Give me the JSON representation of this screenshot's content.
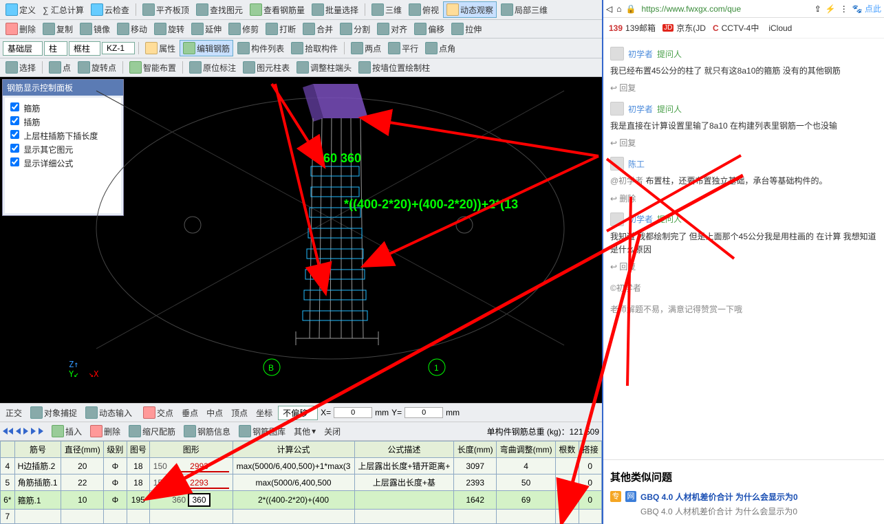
{
  "toolbars": {
    "row1": [
      "定义",
      "∑ 汇总计算",
      "云检查",
      "平齐板顶",
      "查找图元",
      "查看钢筋量",
      "批量选择",
      "三维",
      "俯视",
      "动态观察",
      "局部三维"
    ],
    "row2": [
      "删除",
      "复制",
      "镜像",
      "移动",
      "旋转",
      "延伸",
      "修剪",
      "打断",
      "合并",
      "分割",
      "对齐",
      "偏移",
      "拉伸"
    ],
    "row3_selects": {
      "floor": "基础层",
      "type": "柱",
      "shape": "框柱",
      "id": "KZ-1"
    },
    "row3": [
      "属性",
      "编辑钢筋",
      "构件列表",
      "拾取构件",
      "两点",
      "平行",
      "点角"
    ],
    "row4": [
      "选择",
      "点",
      "旋转点",
      "智能布置",
      "原位标注",
      "图元柱表",
      "调整柱端头",
      "按墙位置绘制柱"
    ]
  },
  "panel": {
    "title": "钢筋显示控制面板",
    "items": [
      "箍筋",
      "插筋",
      "上层柱插筋下插长度",
      "显示其它图元",
      "显示详细公式"
    ]
  },
  "viewport": {
    "dim": "360 360",
    "formula": "*((400-2*20)+(400-2*20))+2*(13",
    "gridB": "B",
    "gridNum": "1"
  },
  "statusbar": {
    "items": [
      "正交",
      "对象捕捉",
      "动态输入",
      "交点",
      "垂点",
      "中点",
      "顶点",
      "坐标"
    ],
    "offset": "不偏移",
    "x_lbl": "X=",
    "x": "0",
    "mm": "mm",
    "y_lbl": "Y=",
    "y": "0"
  },
  "bottombar": {
    "items": [
      "插入",
      "删除",
      "缩尺配筋",
      "钢筋信息",
      "钢筋图库",
      "其他",
      "关闭"
    ],
    "total_label": "单构件钢筋总重 (kg)：",
    "total": "121.509"
  },
  "table": {
    "headers": [
      "",
      "筋号",
      "直径(mm)",
      "级别",
      "图号",
      "图形",
      "计算公式",
      "公式描述",
      "长度(mm)",
      "弯曲调整(mm)",
      "根数",
      "搭接"
    ],
    "rows": [
      {
        "n": "4",
        "name": "H边插筋.2",
        "dia": "20",
        "lvl": "Φ",
        "tu": "18",
        "shape_lead": "150",
        "shape_val": "2993",
        "calc": "max(5000/6,400,500)+1*max(3",
        "desc": "上层露出长度+错开距离+",
        "len": "3097",
        "bend": "4",
        "cnt": "",
        "lap": "0"
      },
      {
        "n": "5",
        "name": "角筋插筋.1",
        "dia": "22",
        "lvl": "Φ",
        "tu": "18",
        "shape_lead": "150",
        "shape_val": "2293",
        "calc": "max(5000/6,400,500",
        "desc": "上层露出长度+基",
        "len": "2393",
        "bend": "50",
        "cnt": "",
        "lap": "0"
      },
      {
        "n": "6*",
        "name": "箍筋.1",
        "dia": "10",
        "lvl": "Φ",
        "tu": "195",
        "shape_lead": "360",
        "shape_val": "360",
        "calc": "2*((400-2*20)+(400",
        "desc": "",
        "len": "1642",
        "bend": "69",
        "cnt": "8",
        "lap": "0",
        "sel": true
      },
      {
        "n": "7",
        "name": "",
        "dia": "",
        "lvl": "",
        "tu": "",
        "shape_lead": "",
        "shape_val": "",
        "calc": "",
        "desc": "",
        "len": "",
        "bend": "",
        "cnt": "",
        "lap": ""
      }
    ]
  },
  "browser": {
    "url": "https://www.fwxgx.com/que",
    "bookmarks": [
      {
        "icon": "139",
        "label": "139邮箱"
      },
      {
        "icon": "JD",
        "label": "京东(JD"
      },
      {
        "icon": "C",
        "label": "CCTV-4中"
      },
      {
        "icon": "",
        "label": "iCloud"
      }
    ],
    "comments": [
      {
        "user": "初学者",
        "role": "提问人",
        "text": "我已经布置45公分的柱了 就只有这8a10的箍筋 没有的其他钢筋",
        "reply": "回复"
      },
      {
        "user": "初学者",
        "role": "提问人",
        "text": "我是直接在计算设置里输了8a10 在构建列表里钢筋一个也没输",
        "reply": "回复"
      },
      {
        "user": "陈工",
        "role": "",
        "at": "@初学者",
        "text": "布置柱，还要布置独立基础，承台等基础构件的。",
        "reply": "删除"
      },
      {
        "user": "初学者",
        "role": "提问人",
        "text": "我知道 我都绘制完了 但是上面那个45公分我是用柱画的 在计算 我想知道是什么原因",
        "reply": "回复"
      }
    ],
    "mention": "©初学者",
    "tip": "老师解题不易，满意记得赞赏一下哦",
    "similar_title": "其他类似问题",
    "similar_q": "GBQ 4.0 人材机差价合计 为什么会显示为0",
    "similar_sub": "GBQ 4.0    人材机差价合计 为什么会显示为0"
  }
}
